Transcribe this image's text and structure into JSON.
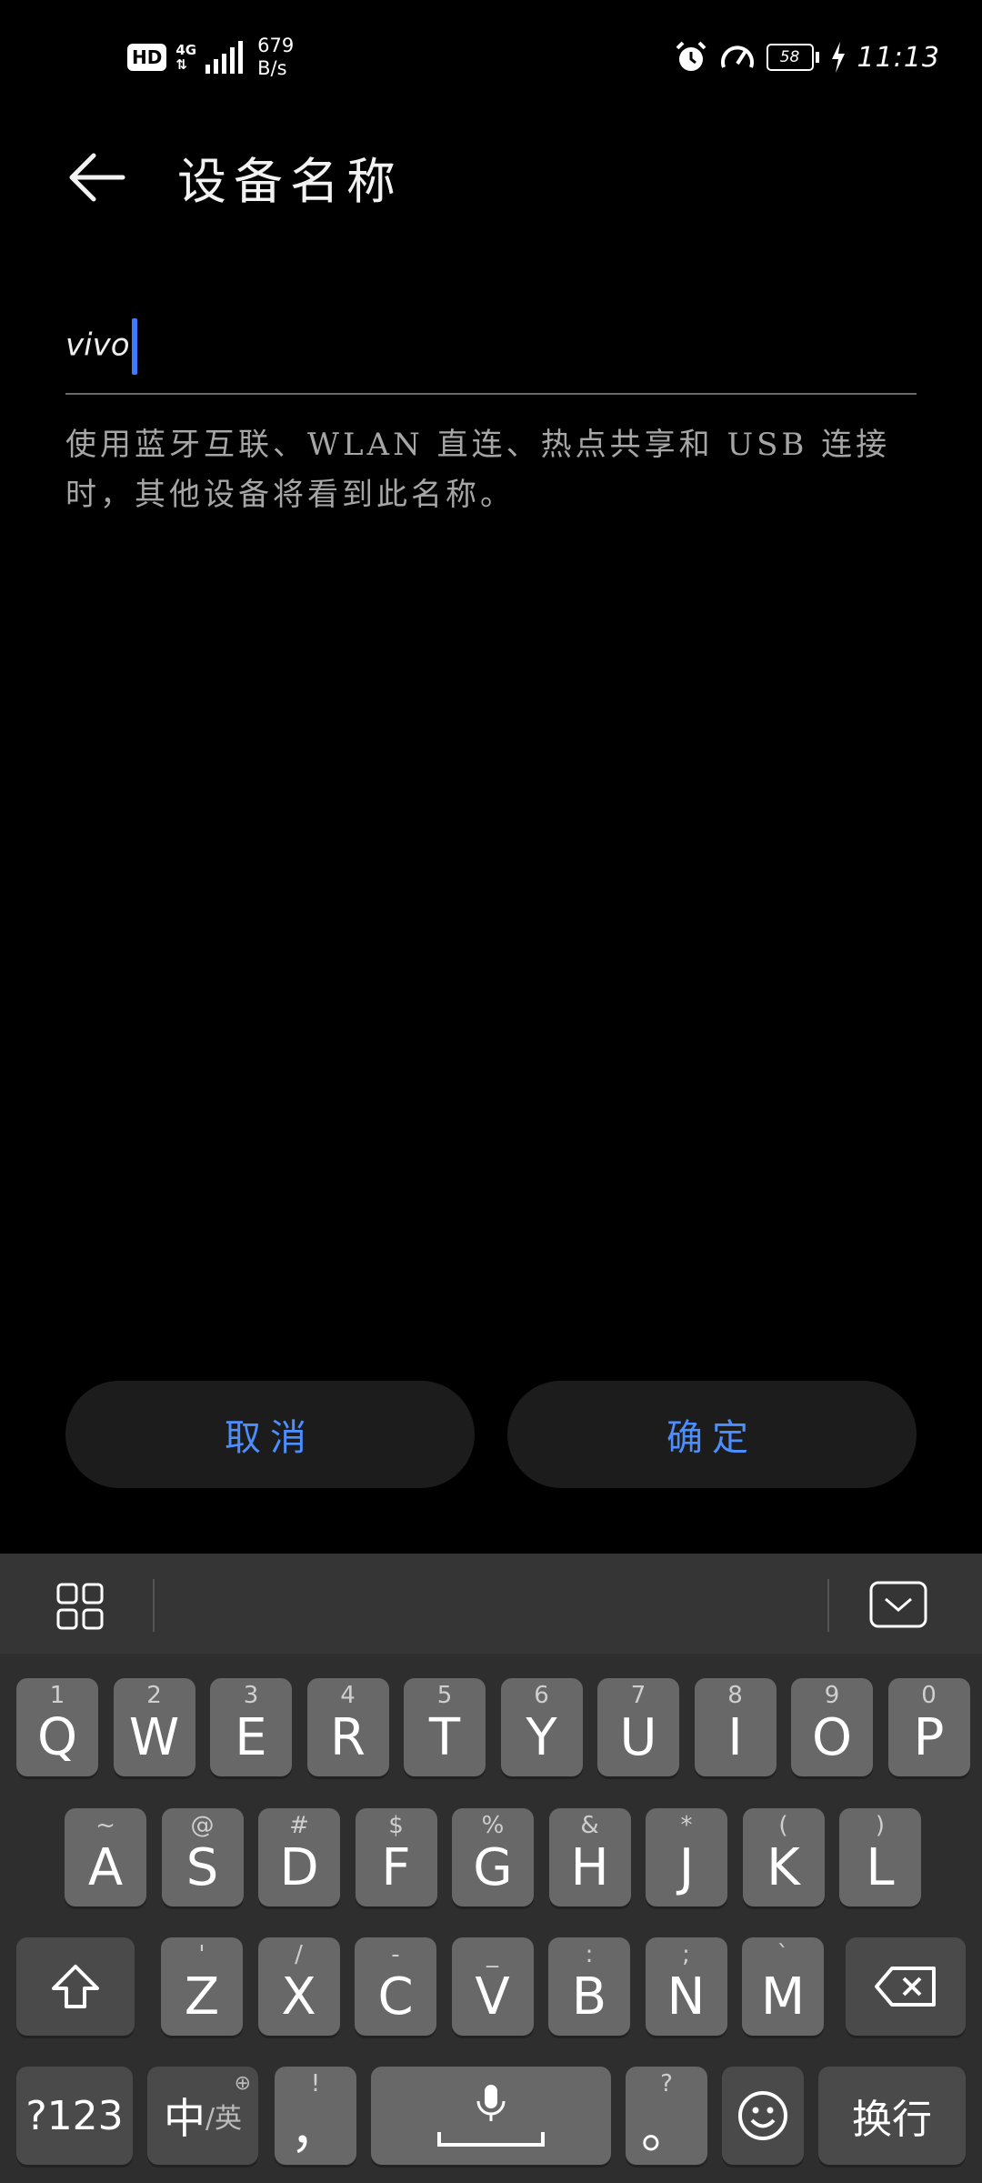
{
  "status_bar": {
    "network_badge": "HD",
    "network_type": "4G",
    "signal_arrows": "⇅",
    "speed_value": "679",
    "speed_unit": "B/s",
    "battery_level": "58",
    "time": "11:13"
  },
  "header": {
    "title": "设备名称"
  },
  "name_input": {
    "value": "vivo"
  },
  "hint_text": "使用蓝牙互联、WLAN 直连、热点共享和 USB 连接时，其他设备将看到此名称。",
  "buttons": {
    "cancel_label": "取消",
    "confirm_label": "确定"
  },
  "colors": {
    "accent": "#4d8eff",
    "caret": "#3c7bff",
    "background": "#000000",
    "keyboard_bg": "#2e2e2e",
    "key_bg": "#686868"
  },
  "keyboard": {
    "row1": [
      {
        "main": "Q",
        "sup": "1"
      },
      {
        "main": "W",
        "sup": "2"
      },
      {
        "main": "E",
        "sup": "3"
      },
      {
        "main": "R",
        "sup": "4"
      },
      {
        "main": "T",
        "sup": "5"
      },
      {
        "main": "Y",
        "sup": "6"
      },
      {
        "main": "U",
        "sup": "7"
      },
      {
        "main": "I",
        "sup": "8"
      },
      {
        "main": "O",
        "sup": "9"
      },
      {
        "main": "P",
        "sup": "0"
      }
    ],
    "row2": [
      {
        "main": "A",
        "sup": "~"
      },
      {
        "main": "S",
        "sup": "@"
      },
      {
        "main": "D",
        "sup": "#"
      },
      {
        "main": "F",
        "sup": "$"
      },
      {
        "main": "G",
        "sup": "%"
      },
      {
        "main": "H",
        "sup": "&"
      },
      {
        "main": "J",
        "sup": "*"
      },
      {
        "main": "K",
        "sup": "("
      },
      {
        "main": "L",
        "sup": ")"
      }
    ],
    "row3": [
      {
        "main": "Z",
        "sup": "'"
      },
      {
        "main": "X",
        "sup": "/"
      },
      {
        "main": "C",
        "sup": "-"
      },
      {
        "main": "V",
        "sup": "_"
      },
      {
        "main": "B",
        "sup": ":"
      },
      {
        "main": "N",
        "sup": ";"
      },
      {
        "main": "M",
        "sup": "`"
      }
    ],
    "symbols_label": "?123",
    "lang_main": "中",
    "lang_alt": "/英",
    "comma_main": "，",
    "comma_sup": "!",
    "period_main": "。",
    "period_sup": "?",
    "enter_label": "换行"
  }
}
